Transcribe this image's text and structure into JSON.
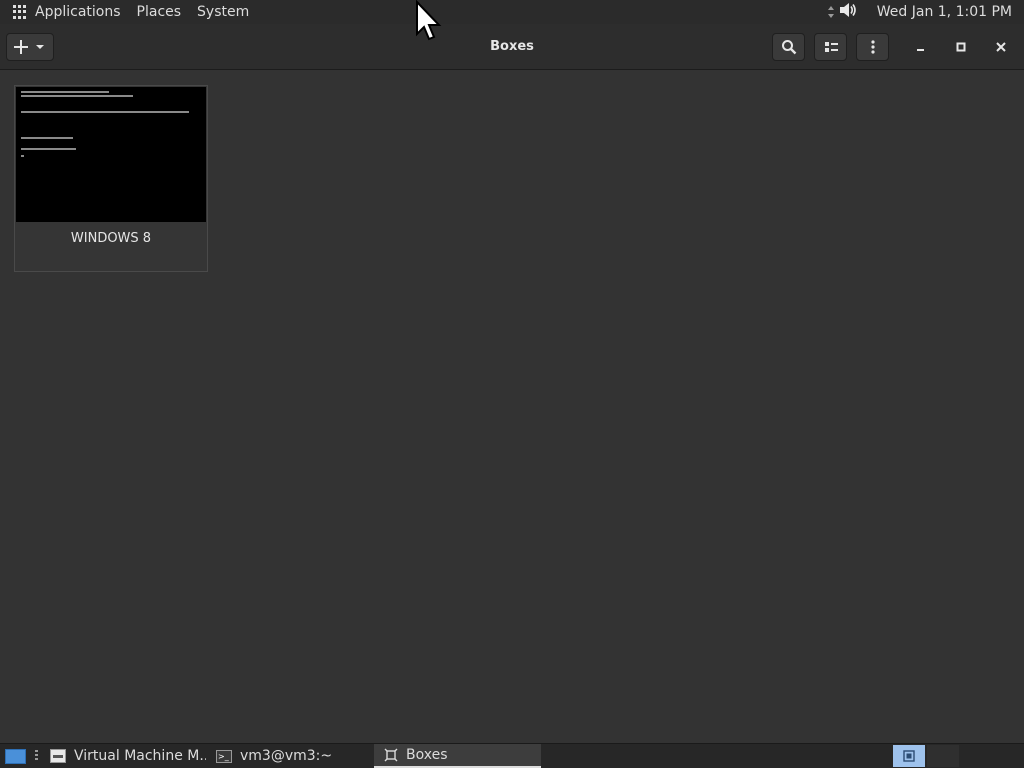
{
  "top_panel": {
    "menu": [
      "Applications",
      "Places",
      "System"
    ],
    "clock": "Wed Jan  1,  1:01 PM",
    "icons": [
      "apps-grid-icon",
      "network-icon",
      "volume-icon"
    ]
  },
  "headerbar": {
    "title": "Boxes",
    "buttons": [
      "new-box-button",
      "search-button",
      "view-toggle-button",
      "app-menu-button"
    ],
    "window_controls": [
      "minimize",
      "maximize",
      "close"
    ]
  },
  "boxes": [
    {
      "name": "WINDOWS 8",
      "thumbnail_icon": "console-screen"
    }
  ],
  "taskbar": {
    "tasks": [
      {
        "label": "Virtual Machine M...",
        "icon": "virt-manager-icon"
      },
      {
        "label": "vm3@vm3:~",
        "icon": "terminal-icon"
      },
      {
        "label": "Boxes",
        "icon": "boxes-icon",
        "active": true
      }
    ],
    "workspaces": 2,
    "active_workspace": 1
  },
  "colors": {
    "panel_bg": "#2b2b2b",
    "headerbar_bg": "#2d2d2d",
    "content_bg": "#333333",
    "accent": "#4a90d9",
    "workspace_active": "#9ec2ec"
  }
}
